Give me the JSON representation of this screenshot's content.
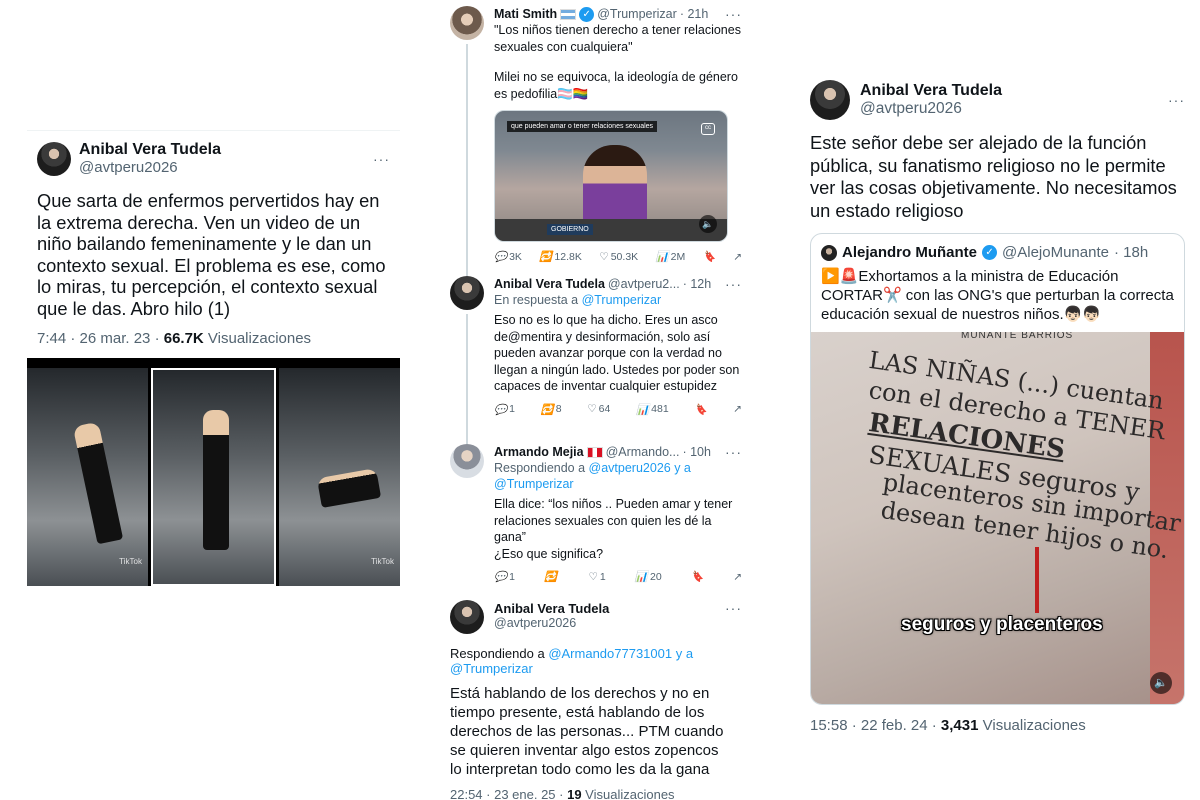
{
  "left": {
    "name": "Anibal Vera Tudela",
    "handle": "@avtperu2026",
    "text": "Que sarta de enfermos pervertidos hay en la extrema derecha. Ven un video de un niño bailando femeninamente y le dan un contexto sexual. El problema es ese, como lo miras, tu percepción, el contexto sexual que le das. Abro hilo (1)",
    "time": "7:44 · 26 mar. 23 · ",
    "views_count": "66.7K",
    "views_label": " Visualizaciones",
    "video_watermark": "TikTok"
  },
  "middle": {
    "tweet1": {
      "name": "Mati Smith",
      "handle": "@Trumperizar",
      "time": "· 21h",
      "text1": "\"Los niños tienen derecho a tener relaciones sexuales con cualquiera\"",
      "text2": "Milei no se equivoca, la ideología de género es pedofilia🏳️‍⚧️🏳️‍🌈",
      "clip_caption": "que pueden amar o tener relaciones sexuales",
      "clip_sign": "GOBIERNO",
      "actions": {
        "replies": "3K",
        "retweets": "12.8K",
        "likes": "50.3K",
        "views": "2M"
      }
    },
    "tweet2": {
      "name": "Anibal Vera Tudela",
      "handle": "@avtperu2...",
      "time": "· 12h",
      "reply_prefix": "En respuesta a ",
      "reply_to": "@Trumperizar",
      "text": "Eso no es lo que ha dicho. Eres un asco de@mentira y desinformación, solo así pueden avanzar porque con la verdad no llegan a ningún lado. Ustedes por poder son capaces de inventar cualquier estupidez",
      "actions": {
        "replies": "1",
        "retweets": "8",
        "likes": "64",
        "views": "481"
      }
    },
    "tweet3": {
      "name": "Armando Mejia",
      "handle": "@Armando...",
      "time": "· 10h",
      "reply_prefix": "Respondiendo a ",
      "reply_to": "@avtperu2026 y a @Trumperizar",
      "text1": "Ella dice: “los niños .. Pueden amar y tener relaciones sexuales con quien les dé la gana”",
      "text2": "¿Eso que significa?",
      "actions": {
        "replies": "1",
        "retweets": "",
        "likes": "1",
        "views": "20"
      }
    },
    "tweet4": {
      "name": "Anibal Vera Tudela",
      "handle": "@avtperu2026",
      "reply_prefix": "Respondiendo a ",
      "reply_to": "@Armando77731001 y a @Trumperizar",
      "text": "Está hablando de los derechos y no en tiempo presente, está hablando de los derechos de las personas... PTM cuando se quieren inventar algo estos zopencos lo interpretan todo como les da la gana",
      "time": "22:54 · 23 ene. 25 · ",
      "views_count": "19",
      "views_label": " Visualizaciones"
    }
  },
  "right": {
    "name": "Anibal Vera Tudela",
    "handle": "@avtperu2026",
    "text": "Este señor debe ser alejado de la función pública, su fanatismo religioso no le permite ver las cosas objetivamente. No necesitamos un estado religioso",
    "quote": {
      "name": "Alejandro Muñante",
      "handle": "@AlejoMunante",
      "time": "· 18h",
      "text": "▶️🚨Exhortamos a la ministra de Educación CORTAR✂️ con las ONG's que perturban la correcta educación sexual de nuestros niños.👦🏻👦🏻",
      "image_lines": [
        "LAS NIÑAS (...) cuentan",
        "con el derecho a TENER",
        "RELACIONES",
        "SEXUALES seguros y",
        "placenteros sin importar si",
        "desean tener hijos o no."
      ],
      "image_header": "MUÑANTE BARRIOS",
      "subtitle": "seguros y placenteros"
    },
    "time": "15:58 · 22 feb. 24 · ",
    "views_count": "3,431",
    "views_label": " Visualizaciones"
  },
  "icons": {
    "reply": "💬",
    "retweet": "🔁",
    "like": "♡",
    "views": "📊",
    "bookmark": "🔖",
    "share": "↗",
    "more": "···",
    "volume": "🔈",
    "verified": "✓"
  }
}
